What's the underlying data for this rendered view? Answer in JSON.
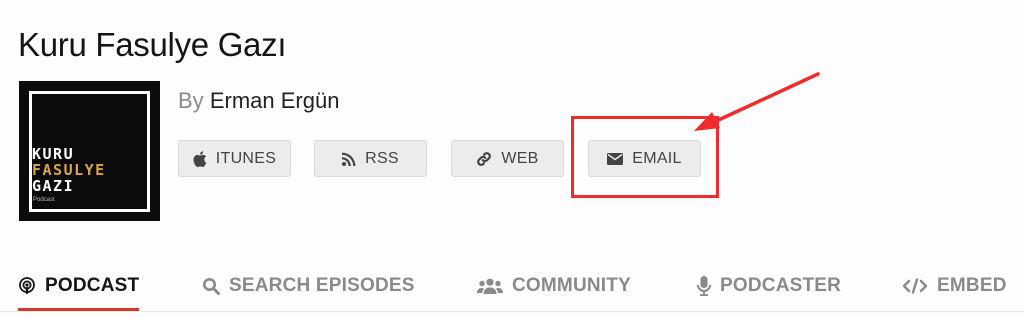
{
  "podcast": {
    "title": "Kuru Fasulye Gazı",
    "by_label": "By",
    "author": "Erman Ergün",
    "cover": {
      "line1": "KURU",
      "line2": "FASULYE",
      "line3": "GAZI",
      "small": "Podcast",
      "accent_color": "#d9a54a"
    }
  },
  "subscribe_buttons": [
    {
      "label": "ITUNES",
      "icon": "apple-icon"
    },
    {
      "label": "RSS",
      "icon": "rss-icon"
    },
    {
      "label": "WEB",
      "icon": "link-icon"
    },
    {
      "label": "EMAIL",
      "icon": "envelope-icon"
    }
  ],
  "annotation": {
    "color": "#ef2b2b",
    "highlighted_button": "EMAIL"
  },
  "tabs": [
    {
      "label": "PODCAST",
      "icon": "podcast-icon",
      "active": true
    },
    {
      "label": "SEARCH EPISODES",
      "icon": "search-icon",
      "active": false
    },
    {
      "label": "COMMUNITY",
      "icon": "users-icon",
      "active": false
    },
    {
      "label": "PODCASTER",
      "icon": "microphone-icon",
      "active": false
    },
    {
      "label": "EMBED",
      "icon": "code-icon",
      "active": false
    }
  ],
  "colors": {
    "active_tab_underline": "#d13a2a",
    "button_bg": "#ececec"
  }
}
